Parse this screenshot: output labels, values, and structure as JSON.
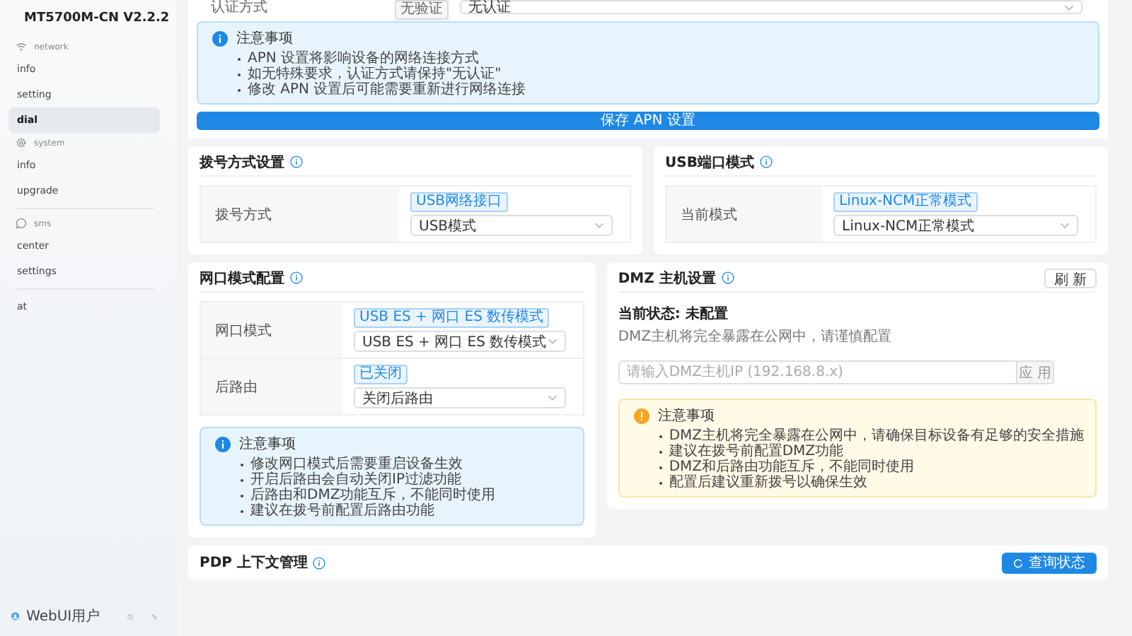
{
  "sidebar": {
    "brand": "MT5700M-CN V2.2.2",
    "groups": [
      {
        "kind": "network",
        "title": "network",
        "items": [
          {
            "label": "info",
            "selected": false
          },
          {
            "label": "setting",
            "selected": false
          },
          {
            "label": "dial",
            "selected": true
          }
        ]
      },
      {
        "kind": "system",
        "title": "system",
        "items": [
          {
            "label": "info",
            "selected": false
          },
          {
            "label": "upgrade",
            "selected": false
          }
        ]
      },
      {
        "kind": "sms",
        "title": "sms",
        "items": [
          {
            "label": "center",
            "selected": false
          },
          {
            "label": "settings",
            "selected": false
          }
        ]
      },
      {
        "items": [
          {
            "label": "at",
            "selected": false
          }
        ]
      }
    ],
    "user": "WebUI用户"
  },
  "apn": {
    "row": {
      "label": "认证方式",
      "badge": "无验证",
      "value": "无认证"
    },
    "notice": {
      "kind": "info",
      "title": "注意事项",
      "items": [
        "APN 设置将影响设备的网络连接方式",
        "如无特殊要求，认证方式请保持\"无认证\"",
        "修改 APN 设置后可能需要重新进行网络连接"
      ]
    },
    "save_button": "保存 APN 设置"
  },
  "dial_card": {
    "title": "拨号方式设置",
    "rows": [
      {
        "label": "拨号方式",
        "badge": "USB网络接口",
        "value": "USB模式"
      }
    ]
  },
  "usb_card": {
    "title": "USB端口模式",
    "rows": [
      {
        "label": "当前模式",
        "badge": "Linux-NCM正常模式",
        "value": "Linux-NCM正常模式"
      }
    ]
  },
  "port_card": {
    "title": "网口模式配置",
    "rows": [
      {
        "label": "网口模式",
        "badge": "USB ES + 网口 ES 数传模式",
        "value": "USB ES + 网口 ES 数传模式"
      },
      {
        "label": "后路由",
        "badge": "已关闭",
        "value": "关闭后路由"
      }
    ],
    "notice": {
      "kind": "info",
      "title": "注意事项",
      "items": [
        "修改网口模式后需要重启设备生效",
        "开启后路由会自动关闭IP过滤功能",
        "后路由和DMZ功能互斥，不能同时使用",
        "建议在拨号前配置后路由功能"
      ]
    }
  },
  "dmz_card": {
    "title": "DMZ 主机设置",
    "refresh_button": "刷 新",
    "status": "当前状态: 未配置",
    "description": "DMZ主机将完全暴露在公网中，请谨慎配置",
    "input": {
      "placeholder": "请输入DMZ主机IP (192.168.8.x)"
    },
    "apply_button": "应 用",
    "notice": {
      "kind": "warning",
      "title": "注意事项",
      "items": [
        "DMZ主机将完全暴露在公网中，请确保目标设备有足够的安全措施",
        "建议在拨号前配置DMZ功能",
        "DMZ和后路由功能互斥，不能同时使用",
        "配置后建议重新拨号以确保生效"
      ]
    }
  },
  "pdp_card": {
    "title": "PDP 上下文管理",
    "query_button": "查询状态"
  }
}
